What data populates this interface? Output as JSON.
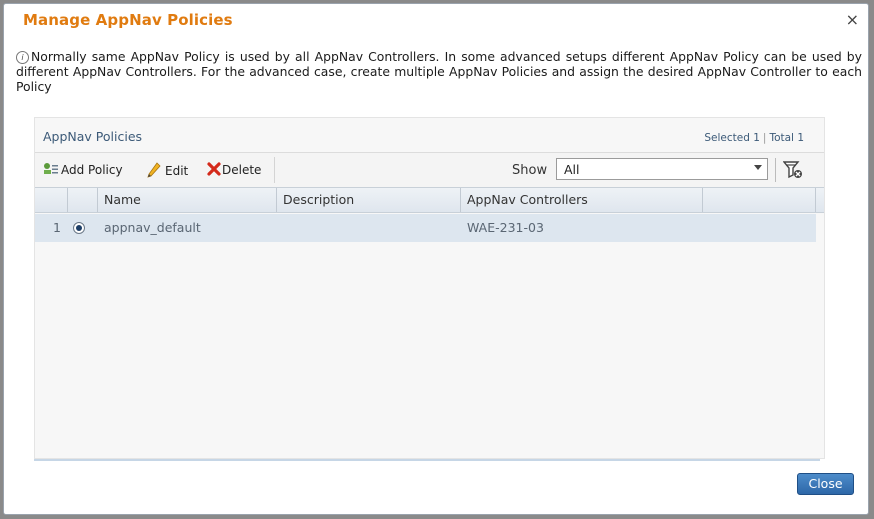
{
  "dialog": {
    "title": "Manage AppNav Policies",
    "close_glyph": "×",
    "info_icon": "info-icon",
    "info_text": "Normally same AppNav Policy is used by all AppNav Controllers. In some advanced setups different AppNav Policy can be used by different AppNav Controllers. For the advanced case, create multiple AppNav Policies and assign the desired AppNav Controller to each Policy"
  },
  "panel": {
    "title": "AppNav Policies",
    "selected": "Selected 1",
    "total": "Total 1"
  },
  "toolbar": {
    "add_label": "Add Policy",
    "edit_label": "Edit",
    "delete_label": "Delete",
    "show_label": "Show",
    "show_value": "All"
  },
  "table": {
    "columns": [
      "Name",
      "Description",
      "AppNav Controllers"
    ],
    "rows": [
      {
        "index": "1",
        "name": "appnav_default",
        "description": "",
        "controllers": "WAE-231-03",
        "selected": true
      }
    ]
  },
  "footer": {
    "close_label": "Close"
  },
  "colors": {
    "title": "#e07b10",
    "accent_button": "#2d67a8",
    "selected_row": "#dde6ef",
    "delete_icon": "#d42a1b"
  }
}
